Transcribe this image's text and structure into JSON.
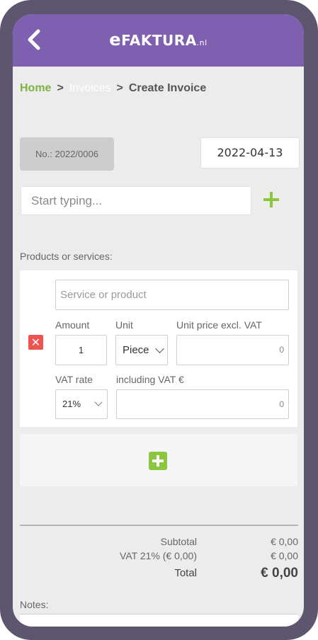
{
  "app": {
    "logo_e": "e",
    "logo_main": "FAKTURA",
    "logo_suffix": ".nl"
  },
  "breadcrumb": {
    "home": "Home",
    "sep1": ">",
    "invoices": "Invoices",
    "sep2": ">",
    "current": "Create Invoice"
  },
  "invoice": {
    "number": "No.: 2022/0006",
    "date": "2022-04-13"
  },
  "client": {
    "placeholder": "Start typing..."
  },
  "products": {
    "section_label": "Products or services:",
    "service_placeholder": "Service or product",
    "amount_label": "Amount",
    "amount_value": "1",
    "unit_label": "Unit",
    "unit_value": "Piece",
    "unit_price_label": "Unit price excl. VAT",
    "unit_price_value": "0",
    "vat_rate_label": "VAT rate",
    "vat_rate_value": "21%",
    "incl_vat_label": "including VAT €",
    "incl_vat_value": "0",
    "delete_symbol": "✕"
  },
  "totals": {
    "subtotal_label": "Subtotal",
    "subtotal_value": "€ 0,00",
    "vat_label": "VAT 21% (€ 0,00)",
    "vat_value": "€ 0,00",
    "total_label": "Total",
    "total_value": "€ 0,00"
  },
  "notes": {
    "label": "Notes:"
  },
  "colors": {
    "header": "#7f5fb0",
    "accent_green": "#8cc63f",
    "delete_red": "#ef5350",
    "frame": "#5e566f"
  },
  "icons": {
    "back": "chevron-left-icon",
    "add_client": "plus-icon",
    "add_line": "plus-square-icon",
    "delete": "close-icon"
  }
}
